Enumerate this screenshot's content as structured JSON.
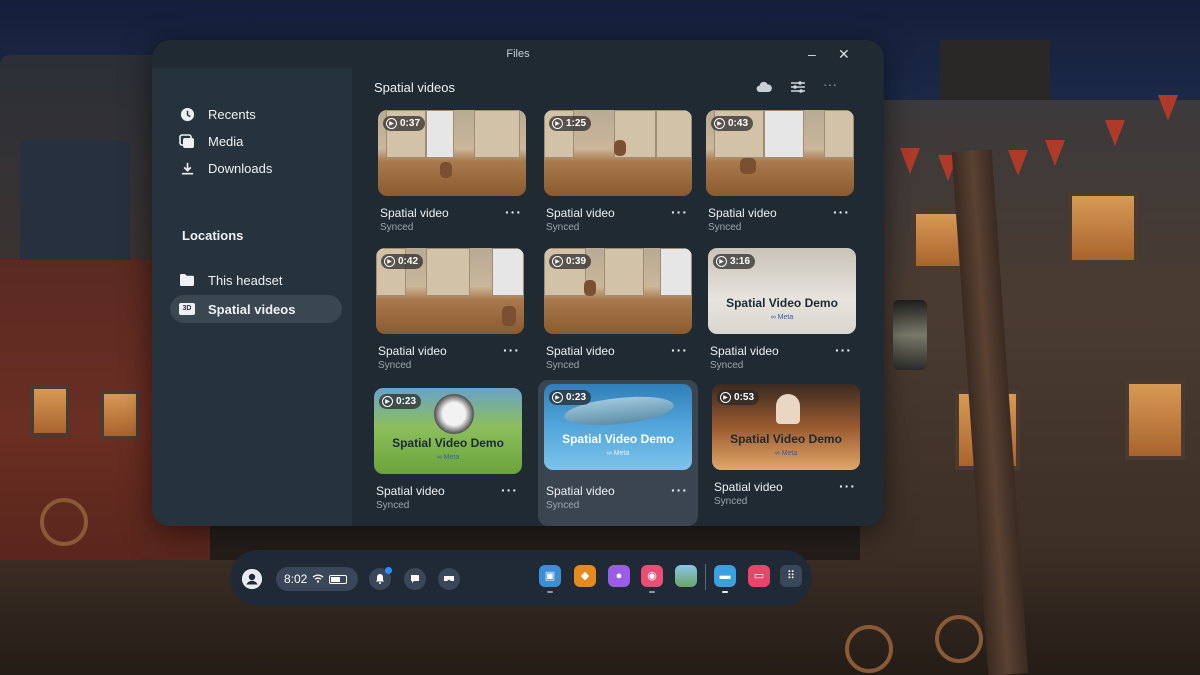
{
  "window": {
    "title": "Files",
    "minimize_glyph": "–",
    "close_glyph": "✕"
  },
  "sidebar": {
    "items": [
      {
        "label": "Recents",
        "icon": "clock-icon"
      },
      {
        "label": "Media",
        "icon": "media-icon"
      },
      {
        "label": "Downloads",
        "icon": "download-icon"
      }
    ],
    "locations_heading": "Locations",
    "locations": [
      {
        "label": "This headset",
        "icon": "folder-icon",
        "active": false
      },
      {
        "label": "Spatial videos",
        "icon": "3d-icon",
        "icon_text": "3D",
        "active": true
      }
    ]
  },
  "main": {
    "title": "Spatial videos",
    "more_glyph": "···",
    "videos": [
      {
        "duration": "0:37",
        "name": "Spatial video",
        "status": "Synced"
      },
      {
        "duration": "1:25",
        "name": "Spatial video",
        "status": "Synced"
      },
      {
        "duration": "0:43",
        "name": "Spatial video",
        "status": "Synced"
      },
      {
        "duration": "0:42",
        "name": "Spatial video",
        "status": "Synced"
      },
      {
        "duration": "0:39",
        "name": "Spatial video",
        "status": "Synced"
      },
      {
        "duration": "3:16",
        "name": "Spatial video",
        "status": "Synced",
        "demo_title": "Spatial Video Demo",
        "demo_brand": "∞ Meta"
      },
      {
        "duration": "0:23",
        "name": "Spatial video",
        "status": "Synced",
        "demo_title": "Spatial Video Demo",
        "demo_brand": "∞ Meta"
      },
      {
        "duration": "0:23",
        "name": "Spatial video",
        "status": "Synced",
        "demo_title": "Spatial Video Demo",
        "demo_brand": "∞ Meta"
      },
      {
        "duration": "0:53",
        "name": "Spatial video",
        "status": "Synced",
        "demo_title": "Spatial Video Demo",
        "demo_brand": "∞ Meta"
      }
    ]
  },
  "taskbar": {
    "time": "8:02",
    "apps": [
      "store-app-icon",
      "shop-app-icon",
      "people-app-icon",
      "camera-app-icon",
      "photos-app-icon",
      "files-app-icon",
      "tv-app-icon",
      "app-library-icon"
    ]
  },
  "colors": {
    "window_bg": "#1f2a33",
    "sidebar_bg": "#27333c",
    "active_item": "#3a4650",
    "notification": "#2f8cff"
  }
}
